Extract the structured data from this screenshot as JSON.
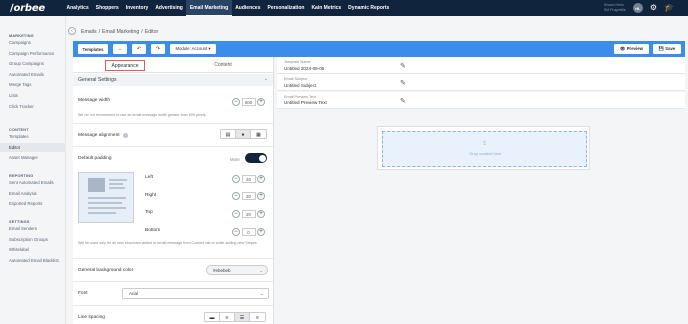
{
  "app": {
    "logo": "orbee"
  },
  "nav": [
    "Analytics",
    "Shoppers",
    "Inventory",
    "Advertising",
    "Email Marketing",
    "Audiences",
    "Personalization",
    "Kain Metrics",
    "Dynamic Reports"
  ],
  "active_nav_index": 4,
  "user": {
    "name_line1": "Shawn Helm",
    "name_line2": "SM Prugmittle",
    "initials": "HL"
  },
  "sidebar": {
    "marketing_heading": "MARKETING",
    "marketing": [
      "Campaigns",
      "Campaign Performance",
      "Group Campaigns",
      "Automated Emails",
      "Merge Tags",
      "Lists",
      "Click Tracker"
    ],
    "content_heading": "CONTENT",
    "content": [
      "Templates",
      "Editor",
      "Asset Manager"
    ],
    "reporting_heading": "REPORTING",
    "reporting": [
      "Sent Automated Emails",
      "Email Analysis",
      "Exported Reports"
    ],
    "settings_heading": "SETTINGS",
    "settings": [
      "Email Senders",
      "Subscription Groups",
      "Whitelabel",
      "Automated Email Blacklist"
    ]
  },
  "breadcrumb": [
    "Emails",
    "/",
    "Email Marketing",
    "/",
    "Editor"
  ],
  "toolbar": {
    "templates": "Templates",
    "module_account": "Module: Account ▾",
    "preview": "👁 Preview",
    "save": "💾 Save",
    "icons": [
      "↔",
      "↶",
      "↷"
    ]
  },
  "panel": {
    "tab_appearance": "Appearance",
    "tab_content": "Content",
    "general_settings": "General Settings",
    "message_width_label": "Message width",
    "message_width_value": "600",
    "width_note": "We do not recommend to use an email message width greater than 600 pixels.",
    "message_alignment_label": "Message alignment",
    "default_padding_label": "Default padding",
    "more_label": "More",
    "padding": [
      {
        "label": "Left",
        "value": "20"
      },
      {
        "label": "Right",
        "value": "20"
      },
      {
        "label": "Top",
        "value": "20"
      },
      {
        "label": "Bottom",
        "value": "0"
      }
    ],
    "padding_note": "Will be used only for all new structures added to email message from Content tab or while adding new Stripes",
    "bg_color_label": "General background color",
    "bg_color_value": "#ebebeb",
    "font_label": "Font",
    "font_value": "Arial",
    "line_spacing_label": "Line spacing"
  },
  "meta": [
    {
      "label": "Template Name",
      "value": "Untitled 2024-09-05"
    },
    {
      "label": "Email Subject",
      "value": "Untitled Subject"
    },
    {
      "label": "Email Preview Text",
      "value": "Untitled Preview Text"
    }
  ],
  "canvas": {
    "drop_text": "Drop content here"
  },
  "colors": {
    "topnav": "#10243d",
    "toolbar": "#3a8dea",
    "accent": "#e05b5b"
  }
}
